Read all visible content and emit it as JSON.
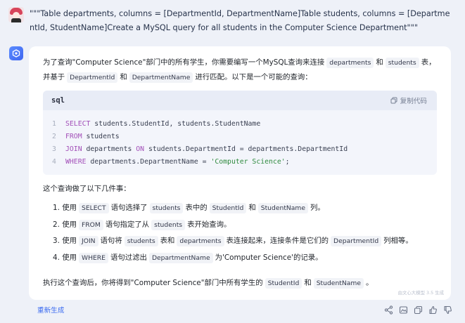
{
  "user_message": "\"\"\"Table departments, columns = [DepartmentId, DepartmentName]Table students, columns = [DepartmentId, StudentName]Create a MySQL query for all students in the Computer Science Department\"\"\"",
  "response": {
    "intro": {
      "l1_a": "为了查询\"Computer Science\"部门中的所有学生，你需要编写一个MySQL查询来连接",
      "l1_c1": "departments",
      "l1_b": "和",
      "l1_c2": "students",
      "l1_c": "表，",
      "l2_a": "并基于",
      "l2_c1": "DepartmentId",
      "l2_b": "和",
      "l2_c2": "DepartmentName",
      "l2_c": "进行匹配。以下是一个可能的查询："
    },
    "code": {
      "lang": "sql",
      "copy_label": "复制代码",
      "lines": [
        {
          "n": "1",
          "kw": "SELECT",
          "rest": " students.StudentId, students.StudentName"
        },
        {
          "n": "2",
          "kw": "FROM",
          "rest": " students"
        },
        {
          "n": "3",
          "kw": "JOIN",
          "mid": " departments ",
          "kw2": "ON",
          "rest": " students.DepartmentId = departments.DepartmentId"
        },
        {
          "n": "4",
          "kw": "WHERE",
          "rest": " departments.DepartmentName = ",
          "str": "'Computer Science'",
          "end": ";"
        }
      ]
    },
    "list_intro": "这个查询做了以下几件事：",
    "items": [
      {
        "a": "1. 使用",
        "c1": "SELECT",
        "b": "语句选择了",
        "c2": "students",
        "c": "表中的",
        "c3": "StudentId",
        "d": "和",
        "c4": "StudentName",
        "e": "列。"
      },
      {
        "a": "2. 使用",
        "c1": "FROM",
        "b": "语句指定了从",
        "c2": "students",
        "c": "表开始查询。"
      },
      {
        "a": "3. 使用",
        "c1": "JOIN",
        "b": "语句将",
        "c2": "students",
        "c": "表和",
        "c3": "departments",
        "d": "表连接起来，连接条件是它们的",
        "c4": "DepartmentId",
        "e": "列相等。"
      },
      {
        "a": "4. 使用",
        "c1": "WHERE",
        "b": "语句过滤出",
        "c2": "DepartmentName",
        "c": "为'Computer Science'的记录。"
      }
    ],
    "outro": {
      "a": "执行这个查询后，你将得到\"Computer Science\"部门中所有学生的",
      "c1": "StudentId",
      "b": "和",
      "c2": "StudentName",
      "c": "。"
    },
    "watermark": "由文心大模型 3.5 生成"
  },
  "footer": {
    "regenerate": "重新生成"
  },
  "icons": {
    "share": "share-icon",
    "image": "image-icon",
    "copy": "copy-icon",
    "like": "thumbs-up-icon",
    "dislike": "thumbs-down-icon"
  },
  "colors": {
    "accent": "#3c6cf0",
    "keyword": "#a24fb8",
    "string": "#2f8a3e",
    "background": "#eef1f8"
  }
}
